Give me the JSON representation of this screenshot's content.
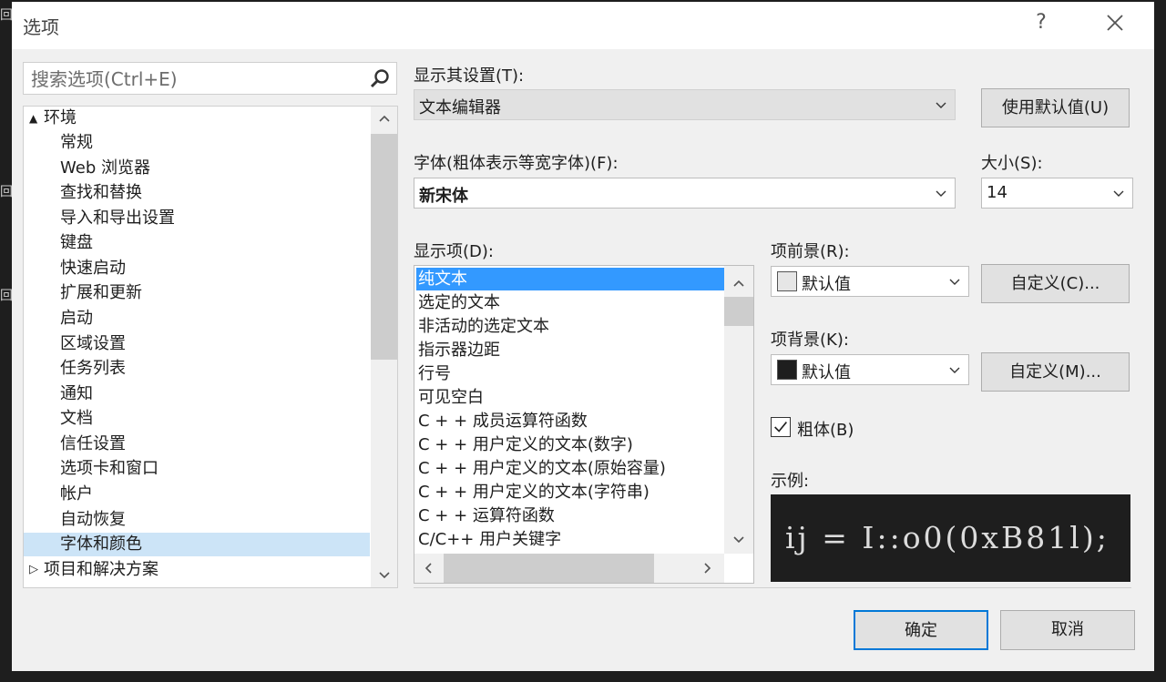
{
  "window": {
    "title": "选项",
    "help_label": "?",
    "close_icon": "close-icon"
  },
  "search": {
    "placeholder": "搜索选项(Ctrl+E)"
  },
  "tree": {
    "items": [
      {
        "label": "环境",
        "expander": "▲",
        "level": 0
      },
      {
        "label": "常规",
        "level": 1
      },
      {
        "label": "Web 浏览器",
        "level": 1
      },
      {
        "label": "查找和替换",
        "level": 1
      },
      {
        "label": "导入和导出设置",
        "level": 1
      },
      {
        "label": "键盘",
        "level": 1
      },
      {
        "label": "快速启动",
        "level": 1
      },
      {
        "label": "扩展和更新",
        "level": 1
      },
      {
        "label": "启动",
        "level": 1
      },
      {
        "label": "区域设置",
        "level": 1
      },
      {
        "label": "任务列表",
        "level": 1
      },
      {
        "label": "通知",
        "level": 1
      },
      {
        "label": "文档",
        "level": 1
      },
      {
        "label": "信任设置",
        "level": 1
      },
      {
        "label": "选项卡和窗口",
        "level": 1
      },
      {
        "label": "帐户",
        "level": 1
      },
      {
        "label": "自动恢复",
        "level": 1
      },
      {
        "label": "字体和颜色",
        "level": 1,
        "selected": true
      },
      {
        "label": "项目和解决方案",
        "expander": "▷",
        "level": 0
      }
    ]
  },
  "settings": {
    "show_settings_label": "显示其设置(T):",
    "show_settings_value": "文本编辑器",
    "use_defaults_button": "使用默认值(U)",
    "font_label": "字体(粗体表示等宽字体)(F):",
    "font_value": "新宋体",
    "size_label": "大小(S):",
    "size_value": "14",
    "display_items_label": "显示项(D):",
    "display_items": [
      "纯文本",
      "选定的文本",
      "非活动的选定文本",
      "指示器边距",
      "行号",
      "可见空白",
      "C + + 成员运算符函数",
      "C + + 用户定义的文本(数字)",
      "C + + 用户定义的文本(原始容量)",
      "C + + 用户定义的文本(字符串)",
      "C + + 运算符函数",
      "C/C++ 用户关键字"
    ],
    "selected_display_item": "纯文本",
    "foreground_label": "项前景(R):",
    "foreground_value": "默认值",
    "foreground_color": "#e6e6e6",
    "custom_fg_button": "自定义(C)...",
    "background_label": "项背景(K):",
    "background_value": "默认值",
    "background_color": "#1e1e1e",
    "custom_bg_button": "自定义(M)...",
    "bold_label": "粗体(B)",
    "bold_checked": true,
    "sample_label": "示例:",
    "sample_text": "ij = I::o0(0xB81l);"
  },
  "footer": {
    "ok_button": "确定",
    "cancel_button": "取消"
  },
  "accent_color": "#3399ff"
}
